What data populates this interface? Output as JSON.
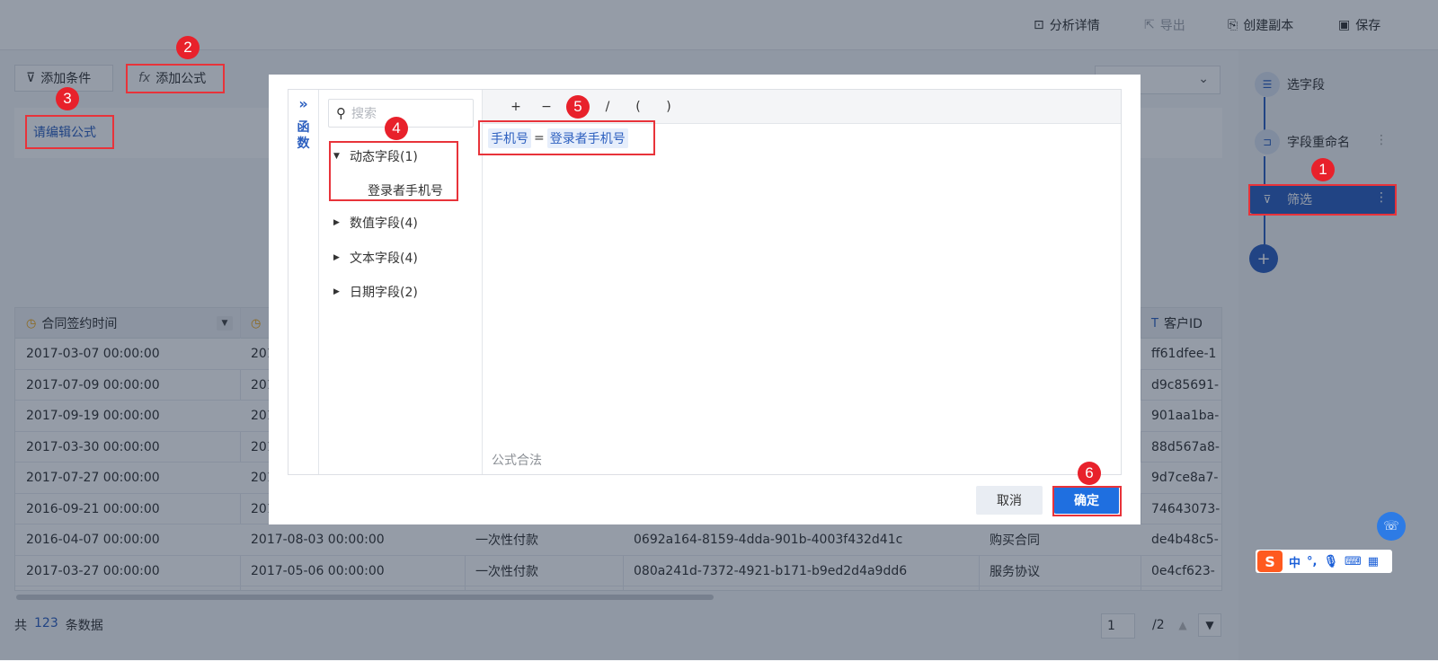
{
  "toolbar": {
    "analysis_detail": "分析详情",
    "export": "导出",
    "create_copy": "创建副本",
    "save": "保存"
  },
  "conditions": {
    "add_condition": "添加条件",
    "add_formula": "添加公式",
    "edit_formula_link": "请编辑公式"
  },
  "table": {
    "headers": [
      "合同签约时间",
      "",
      "",
      "",
      "",
      "客户ID"
    ],
    "rows": [
      [
        "2017-03-07 00:00:00",
        "201",
        "",
        "",
        "",
        "ff61dfee-1"
      ],
      [
        "2017-07-09 00:00:00",
        "201",
        "",
        "",
        "",
        "d9c85691-"
      ],
      [
        "2017-09-19 00:00:00",
        "201",
        "",
        "",
        "",
        "901aa1ba-"
      ],
      [
        "2017-03-30 00:00:00",
        "201",
        "",
        "",
        "",
        "88d567a8-"
      ],
      [
        "2017-07-27 00:00:00",
        "201",
        "",
        "",
        "",
        "9d7ce8a7-"
      ],
      [
        "2016-09-21 00:00:00",
        "201",
        "",
        "",
        "",
        "74643073-"
      ],
      [
        "2016-04-07 00:00:00",
        "2017-08-03 00:00:00",
        "一次性付款",
        "0692a164-8159-4dda-901b-4003f432d41c",
        "购买合同",
        "de4b48c5-"
      ],
      [
        "2017-03-27 00:00:00",
        "2017-05-06 00:00:00",
        "一次性付款",
        "080a241d-7372-4921-b171-b9ed2d4a9dd6",
        "服务协议",
        "0e4cf623-"
      ]
    ]
  },
  "footer": {
    "total_prefix": "共",
    "total_count": "123",
    "total_suffix": "条数据",
    "current_page": "1",
    "page_total": "/2"
  },
  "steps": {
    "items": [
      {
        "label": "选字段"
      },
      {
        "label": "字段重命名"
      },
      {
        "label": "筛选"
      }
    ]
  },
  "dialog": {
    "fn_rail_chars": [
      "函",
      "数"
    ],
    "search_placeholder": "搜索",
    "groups": {
      "dynamic": "动态字段(1)",
      "dynamic_child": "登录者手机号",
      "numeric": "数值字段(4)",
      "text": "文本字段(4)",
      "date": "日期字段(2)"
    },
    "operators": [
      "+",
      "−",
      "",
      "/",
      "(",
      ")"
    ],
    "formula": {
      "left_token": "手机号",
      "eq": "=",
      "right_token": "登录者手机号"
    },
    "validity": "公式合法",
    "cancel": "取消",
    "ok": "确定"
  },
  "badges": [
    "1",
    "2",
    "3",
    "4",
    "5",
    "6"
  ],
  "ime": {
    "logo": "S",
    "chinese": "中"
  },
  "colors": {
    "primary": "#2c5fbf",
    "ok_button": "#1f6fe0",
    "annotation_red": "#e8333a"
  }
}
